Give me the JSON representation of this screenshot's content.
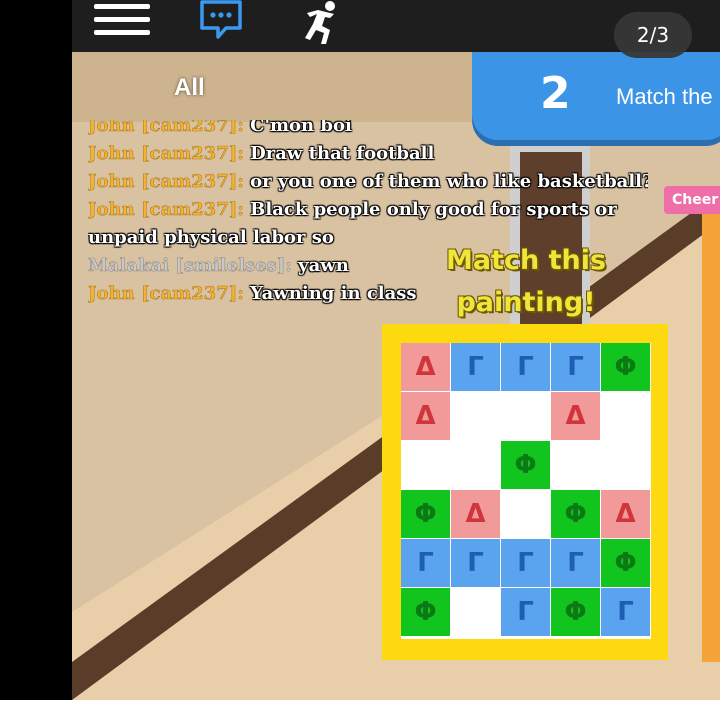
{
  "topbar": {
    "page_indicator": "2/3"
  },
  "task_banner": {
    "number": "2",
    "text": "Match the"
  },
  "chat": {
    "tab_label": "All",
    "messages": [
      {
        "sender": "John [cam237]:",
        "text": "C'mon boi",
        "sender_style": "gold"
      },
      {
        "sender": "John [cam237]:",
        "text": "Draw that football",
        "sender_style": "gold"
      },
      {
        "sender": "John [cam237]:",
        "text": "or you one of them who like basketball?",
        "sender_style": "gold"
      },
      {
        "sender": "John [cam237]:",
        "text": "Black people only good for sports or unpaid physical labor so",
        "sender_style": "gold"
      },
      {
        "sender": "Malakai [smilelses]:",
        "text": "yawn",
        "sender_style": "grey"
      },
      {
        "sender": "John [cam237]:",
        "text": "Yawning in class",
        "sender_style": "gold"
      }
    ]
  },
  "painting": {
    "title": "Match this painting!",
    "rows": [
      [
        {
          "c": "r",
          "s": "Δ"
        },
        {
          "c": "b",
          "s": "Γ"
        },
        {
          "c": "b",
          "s": "Γ"
        },
        {
          "c": "b",
          "s": "Γ"
        },
        {
          "c": "g",
          "s": "Φ"
        }
      ],
      [
        {
          "c": "r",
          "s": "Δ"
        },
        {
          "c": "w",
          "s": ""
        },
        {
          "c": "w",
          "s": ""
        },
        {
          "c": "r",
          "s": "Δ"
        },
        {
          "c": "w",
          "s": ""
        }
      ],
      [
        {
          "c": "w",
          "s": ""
        },
        {
          "c": "w",
          "s": ""
        },
        {
          "c": "g",
          "s": "Φ"
        },
        {
          "c": "w",
          "s": ""
        },
        {
          "c": "w",
          "s": ""
        }
      ],
      [
        {
          "c": "g",
          "s": "Φ"
        },
        {
          "c": "r",
          "s": "Δ"
        },
        {
          "c": "w",
          "s": ""
        },
        {
          "c": "g",
          "s": "Φ"
        },
        {
          "c": "r",
          "s": "Δ"
        }
      ],
      [
        {
          "c": "b",
          "s": "Γ"
        },
        {
          "c": "b",
          "s": "Γ"
        },
        {
          "c": "b",
          "s": "Γ"
        },
        {
          "c": "b",
          "s": "Γ"
        },
        {
          "c": "g",
          "s": "Φ"
        }
      ],
      [
        {
          "c": "g",
          "s": "Φ"
        },
        {
          "c": "w",
          "s": ""
        },
        {
          "c": "b",
          "s": "Γ"
        },
        {
          "c": "g",
          "s": "Φ"
        },
        {
          "c": "b",
          "s": "Γ"
        }
      ]
    ]
  },
  "scene": {
    "sign_text": "Cheer"
  },
  "colors": {
    "banner": "#3b94e6",
    "frame": "#fdd90f",
    "red_cell": "#f29a9a",
    "blue_cell": "#5aa3ee",
    "green_cell": "#11c41e",
    "sender_gold": "#f4b32a"
  }
}
